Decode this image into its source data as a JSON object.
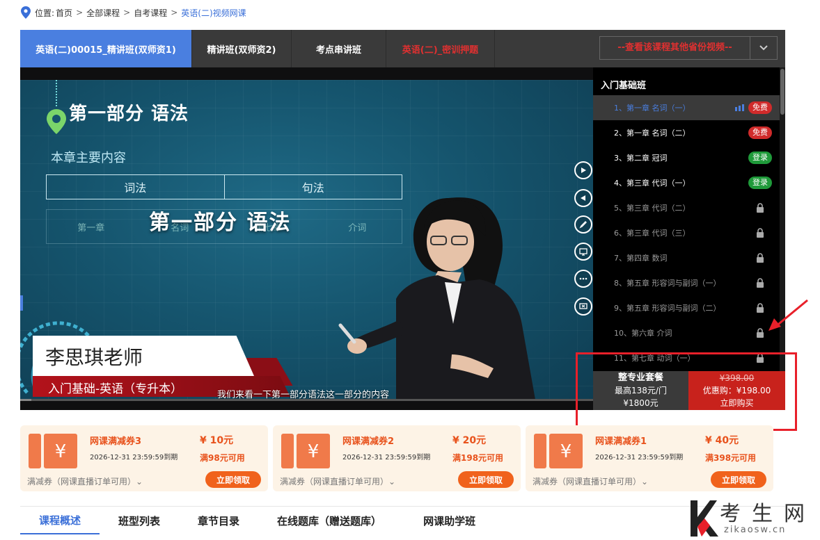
{
  "breadcrumb": {
    "prefix": "位置:",
    "items": [
      "首页",
      "全部课程",
      "自考课程"
    ],
    "separator": ">",
    "current": "英语(二)视频网课"
  },
  "tabs": [
    {
      "label": "英语(二)00015_精讲班(双师资1)",
      "active": true,
      "red": false
    },
    {
      "label": "精讲班(双师资2)",
      "active": false,
      "red": false
    },
    {
      "label": "考点串讲班",
      "active": false,
      "red": false
    },
    {
      "label": "英语(二)_密训押题",
      "active": false,
      "red": true
    }
  ],
  "other_provinces": "--查看该课程其他省份视频--",
  "video": {
    "part_title": "第一部分 语法",
    "chapter_main": "本章主要内容",
    "table_cells": [
      "词法",
      "句法"
    ],
    "table_row2": [
      "第一章",
      "名词",
      "第七章",
      "介词"
    ],
    "overlay_title": "第一部分 语法",
    "teacher": "李思琪老师",
    "course_sub": "入门基础-英语（专升本）",
    "caption": "我们来看一下第一部分语法这一部分的内容",
    "progress": 0.02
  },
  "chapters": {
    "header": "入门基础班",
    "items": [
      {
        "label": "1、第一章 名词（一）",
        "status": "free",
        "badge": "免费",
        "active": true
      },
      {
        "label": "2、第一章 名词（二）",
        "status": "free",
        "badge": "免费",
        "active": false
      },
      {
        "label": "3、第二章 冠词",
        "status": "login",
        "badge": "登录",
        "active": false
      },
      {
        "label": "4、第三章 代词（一）",
        "status": "login",
        "badge": "登录",
        "active": false
      },
      {
        "label": "5、第三章 代词（二）",
        "status": "locked",
        "badge": "",
        "active": false
      },
      {
        "label": "6、第三章 代词（三）",
        "status": "locked",
        "badge": "",
        "active": false
      },
      {
        "label": "7、第四章 数词",
        "status": "locked",
        "badge": "",
        "active": false
      },
      {
        "label": "8、第五章 形容词与副词（一）",
        "status": "locked",
        "badge": "",
        "active": false
      },
      {
        "label": "9、第五章 形容词与副词（二）",
        "status": "locked",
        "badge": "",
        "active": false
      },
      {
        "label": "10、第六章 介词",
        "status": "locked",
        "badge": "",
        "active": false
      },
      {
        "label": "11、第七章 动词（一）",
        "status": "locked",
        "badge": "",
        "active": false
      }
    ]
  },
  "buy": {
    "package_title": "整专业套餐",
    "package_max": "最高138元/门",
    "package_price": "¥1800元",
    "old_price": "¥398.00",
    "promo": "优惠购：¥198.00",
    "buy_now": "立即购买"
  },
  "coupons": [
    {
      "name": "网课满减券3",
      "expiry": "2026-12-31  23:59:59到期",
      "amount": "¥ 10元",
      "condition": "满98元可用",
      "type": "满减券（网课直播订单可用）⌄",
      "button": "立即领取"
    },
    {
      "name": "网课满减券2",
      "expiry": "2026-12-31  23:59:59到期",
      "amount": "¥ 20元",
      "condition": "满198元可用",
      "type": "满减券（网课直播订单可用）⌄",
      "button": "立即领取"
    },
    {
      "name": "网课满减券1",
      "expiry": "2026-12-31  23:59:59到期",
      "amount": "¥ 40元",
      "condition": "满398元可用",
      "type": "满减券（网课直播订单可用）⌄",
      "button": "立即领取"
    }
  ],
  "bottom_tabs": [
    "课程概述",
    "班型列表",
    "章节目录",
    "在线题库（赠送题库）",
    "网课助学班"
  ],
  "watermark": {
    "cn": "考生网",
    "en": "zikaosw.cn"
  },
  "colors": {
    "accent": "#4a7fe0",
    "red": "#c8221c",
    "coupon_orange": "#f0621c",
    "annotation": "#e8202a"
  }
}
